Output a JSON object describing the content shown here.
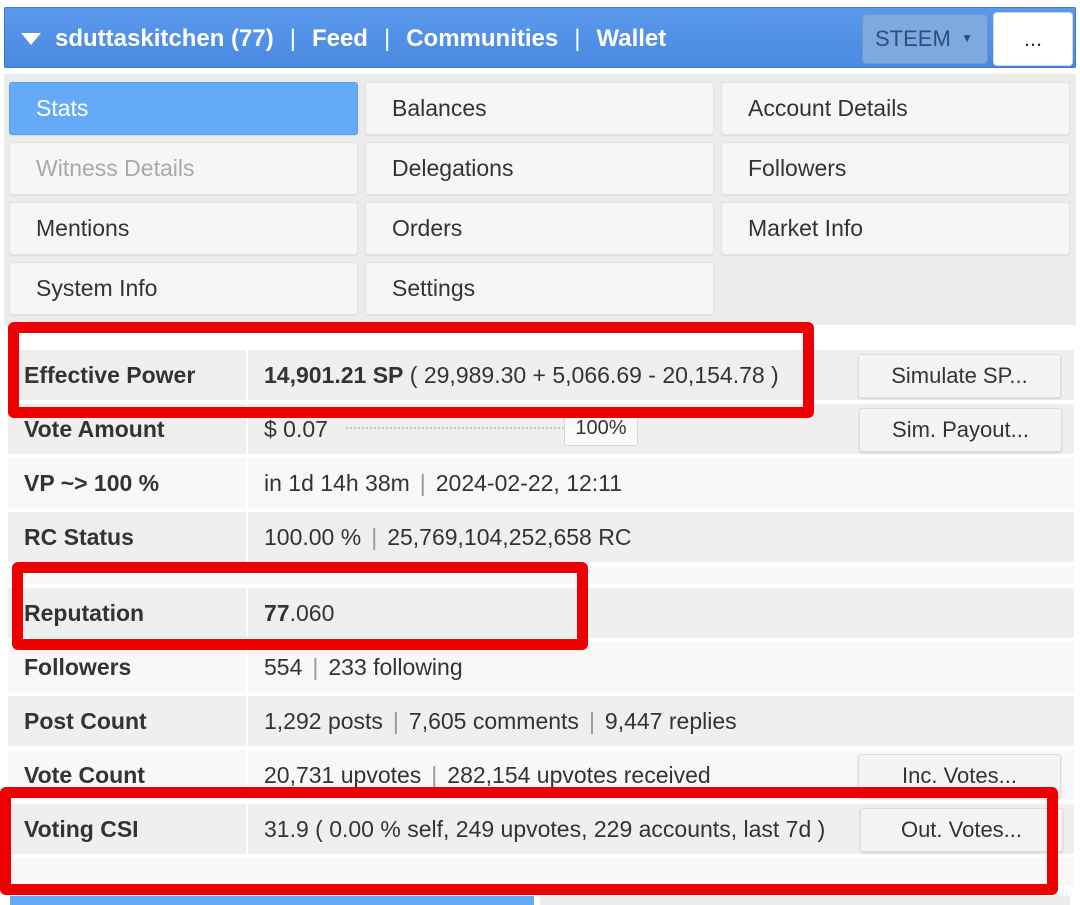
{
  "header": {
    "account": "sduttaskitchen (77)",
    "nav": [
      "Feed",
      "Communities",
      "Wallet"
    ],
    "separator": "|",
    "chain_select": "STEEM",
    "more_label": "..."
  },
  "tabs": [
    {
      "label": "Stats",
      "state": "active"
    },
    {
      "label": "Balances",
      "state": "normal"
    },
    {
      "label": "Account Details",
      "state": "normal"
    },
    {
      "label": "Witness Details",
      "state": "disabled"
    },
    {
      "label": "Delegations",
      "state": "normal"
    },
    {
      "label": "Followers",
      "state": "normal"
    },
    {
      "label": "Mentions",
      "state": "normal"
    },
    {
      "label": "Orders",
      "state": "normal"
    },
    {
      "label": "Market Info",
      "state": "normal"
    },
    {
      "label": "System Info",
      "state": "normal"
    },
    {
      "label": "Settings",
      "state": "normal"
    }
  ],
  "stats": {
    "effective_power": {
      "label": "Effective Power",
      "value_bold": "14,901.21 SP",
      "value_rest": " ( 29,989.30 + 5,066.69 - 20,154.78 )",
      "button": "Simulate SP..."
    },
    "vote_amount": {
      "label": "Vote Amount",
      "value": "$ 0.07",
      "percent": "100%",
      "button": "Sim. Payout..."
    },
    "vp": {
      "label": "VP ~> 100 %",
      "eta": "in 1d 14h 38m",
      "datetime": "2024-02-22, 12:11"
    },
    "rc_status": {
      "label": "RC Status",
      "percent": "100.00 %",
      "amount": "25,769,104,252,658 RC"
    },
    "reputation": {
      "label": "Reputation",
      "whole": "77",
      "fraction": ".060"
    },
    "followers": {
      "label": "Followers",
      "count": "554",
      "following": "233 following"
    },
    "post_count": {
      "label": "Post Count",
      "posts": "1,292 posts",
      "comments": "7,605 comments",
      "replies": "9,447 replies"
    },
    "vote_count": {
      "label": "Vote Count",
      "upvotes": "20,731 upvotes",
      "received": "282,154 upvotes received",
      "button": "Inc. Votes..."
    },
    "voting_csi": {
      "label": "Voting CSI",
      "value": "31.9 ( 0.00 % self, 249 upvotes, 229 accounts, last 7d )",
      "button": "Out. Votes..."
    }
  },
  "colors": {
    "header_blue": "#4a89df",
    "active_tab": "#64aaf6",
    "highlight_red": "#ee0000"
  }
}
